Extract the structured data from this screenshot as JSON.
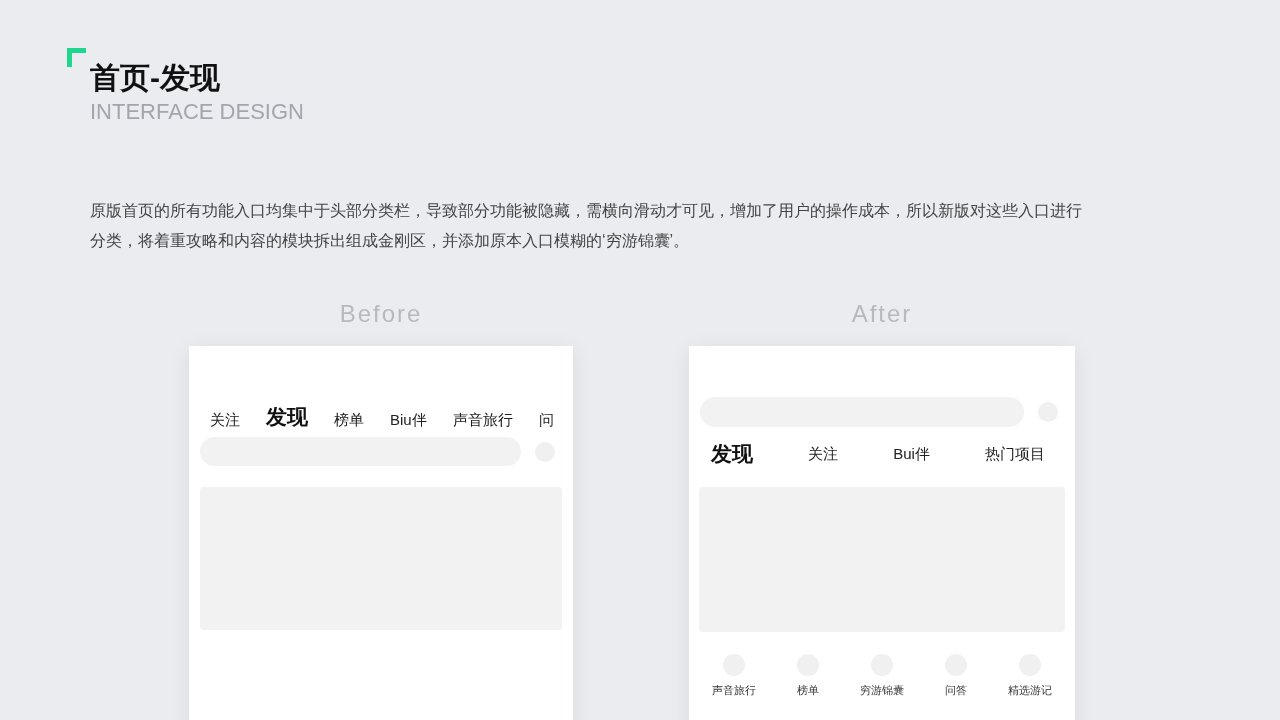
{
  "header": {
    "title": "首页-发现",
    "subtitle": "INTERFACE DESIGN"
  },
  "description": "原版首页的所有功能入口均集中于头部分类栏，导致部分功能被隐藏，需横向滑动才可见，增加了用户的操作成本，所以新版对这些入口进行分类，将着重攻略和内容的模块拆出组成金刚区，并添加原本入口模糊的‘穷游锦囊’。",
  "before": {
    "label": "Before",
    "tabs": [
      {
        "label": "关注",
        "selected": false
      },
      {
        "label": "发现",
        "selected": true
      },
      {
        "label": "榜单",
        "selected": false
      },
      {
        "label": "Biu伴",
        "selected": false
      },
      {
        "label": "声音旅行",
        "selected": false
      },
      {
        "label": "问",
        "selected": false
      }
    ]
  },
  "after": {
    "label": "After",
    "tabs": [
      {
        "label": "发现",
        "selected": true
      },
      {
        "label": "关注",
        "selected": false
      },
      {
        "label": "Bui伴",
        "selected": false
      },
      {
        "label": "热门项目",
        "selected": false
      }
    ],
    "shortcuts": [
      {
        "label": "声音旅行"
      },
      {
        "label": "榜单"
      },
      {
        "label": "穷游锦囊"
      },
      {
        "label": "问答"
      },
      {
        "label": "精选游记"
      }
    ]
  }
}
